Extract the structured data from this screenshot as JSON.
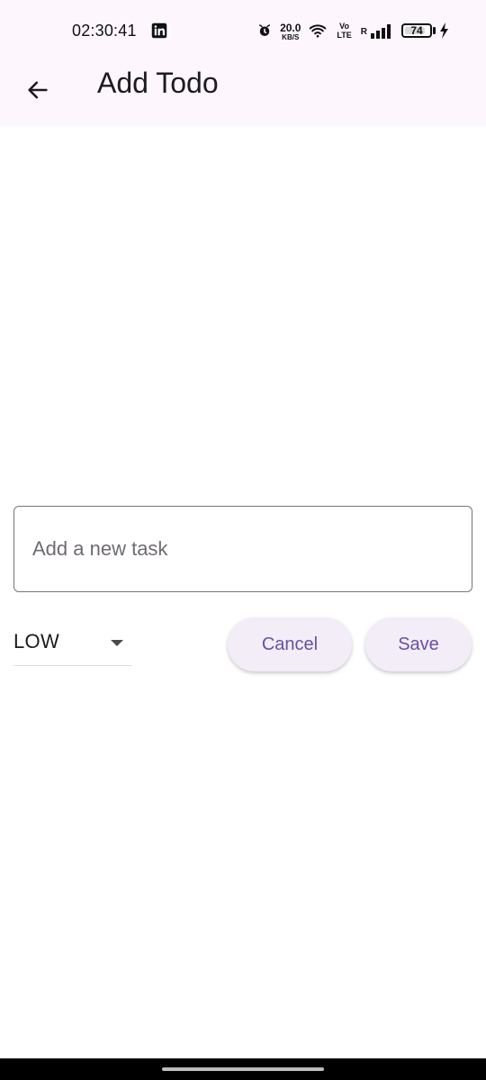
{
  "status_bar": {
    "time": "02:30:41",
    "net_speed_value": "20.0",
    "net_speed_unit": "KB/S",
    "volte_top": "Vo",
    "volte_bottom": "LTE",
    "roaming": "R",
    "battery": "74",
    "icons": [
      "linkedin-icon",
      "alarm-icon",
      "wifi-icon",
      "signal-icon",
      "battery-icon",
      "charging-icon"
    ]
  },
  "app_bar": {
    "title": "Add Todo",
    "back_icon": "arrow-left-icon"
  },
  "form": {
    "task_placeholder": "Add a new task",
    "task_value": "",
    "priority": {
      "selected": "LOW"
    }
  },
  "actions": {
    "cancel_label": "Cancel",
    "save_label": "Save"
  },
  "colors": {
    "accent": "#6750a4",
    "button_bg": "#f3edf7",
    "topbar_bg": "#fdf7fd"
  }
}
